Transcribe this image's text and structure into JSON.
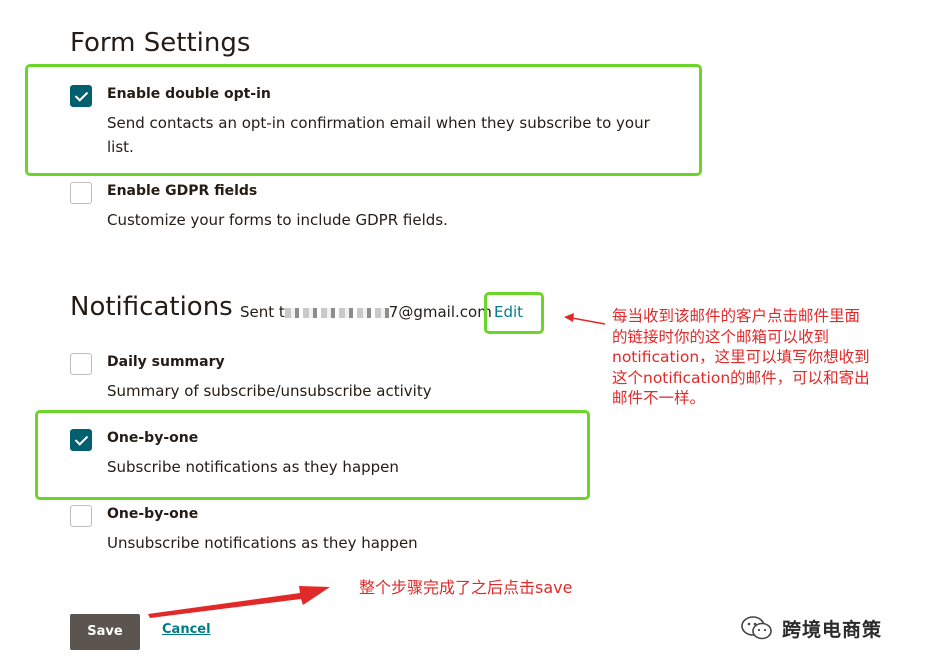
{
  "form_settings": {
    "title": "Form Settings",
    "double_opt_in": {
      "label": "Enable double opt-in",
      "description": "Send contacts an opt-in confirmation email when they subscribe to your list.",
      "checked": true
    },
    "gdpr": {
      "label": "Enable GDPR fields",
      "description": "Customize your forms to include GDPR fields.",
      "checked": false
    }
  },
  "notifications": {
    "title": "Notifications",
    "sent_prefix": "Sent t",
    "sent_suffix": "7@gmail.com",
    "edit_label": "Edit",
    "daily_summary": {
      "label": "Daily summary",
      "description": "Summary of subscribe/unsubscribe activity",
      "checked": false
    },
    "one_by_one_subscribe": {
      "label": "One-by-one",
      "description": "Subscribe notifications as they happen",
      "checked": true
    },
    "one_by_one_unsubscribe": {
      "label": "One-by-one",
      "description": "Unsubscribe notifications as they happen",
      "checked": false
    }
  },
  "annotations": {
    "edit_note": [
      "每当收到该邮件的客户点击邮件里面",
      "的链接时你的这个邮箱可以收到",
      "notification，这里可以填写你想收到",
      "这个notification的邮件，可以和寄出",
      "邮件不一样。"
    ],
    "save_note": "整个步骤完成了之后点击save",
    "color": "#e12929",
    "highlight_color": "#6ad62a"
  },
  "footer": {
    "save_label": "Save",
    "cancel_label": "Cancel"
  },
  "watermark": {
    "text": "跨境电商策"
  },
  "colors": {
    "checkbox_checked": "#00606f",
    "link": "#007c89",
    "save_button": "#5b544f"
  }
}
